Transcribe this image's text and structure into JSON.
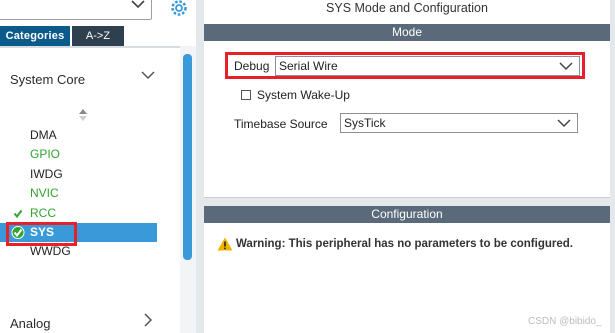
{
  "left": {
    "tabs": {
      "categories": "Categories",
      "az": "A->Z"
    },
    "category": {
      "label": "System Core"
    },
    "items": [
      {
        "label": "DMA",
        "state": "normal"
      },
      {
        "label": "GPIO",
        "state": "green"
      },
      {
        "label": "IWDG",
        "state": "normal"
      },
      {
        "label": "NVIC",
        "state": "green"
      },
      {
        "label": "RCC",
        "state": "checked"
      },
      {
        "label": "SYS",
        "state": "selected"
      },
      {
        "label": "WWDG",
        "state": "normal"
      }
    ],
    "bottom_category": {
      "label": "Analog"
    }
  },
  "right": {
    "title": "SYS Mode and Configuration",
    "mode_header": "Mode",
    "debug": {
      "label": "Debug",
      "value": "Serial Wire"
    },
    "wakeup": {
      "label": "System Wake-Up",
      "checked": false
    },
    "timebase": {
      "label": "Timebase Source",
      "value": "SysTick"
    },
    "config_header": "Configuration",
    "warning": "Warning: This peripheral has no parameters to be configured."
  },
  "watermark": "CSDN @bibido_",
  "colors": {
    "accent_blue": "#3a9ad9",
    "section_bar": "#5a6a7a",
    "highlight_red": "#e8202a",
    "enabled_green": "#2fa52f",
    "warning_yellow": "#f0b400"
  }
}
